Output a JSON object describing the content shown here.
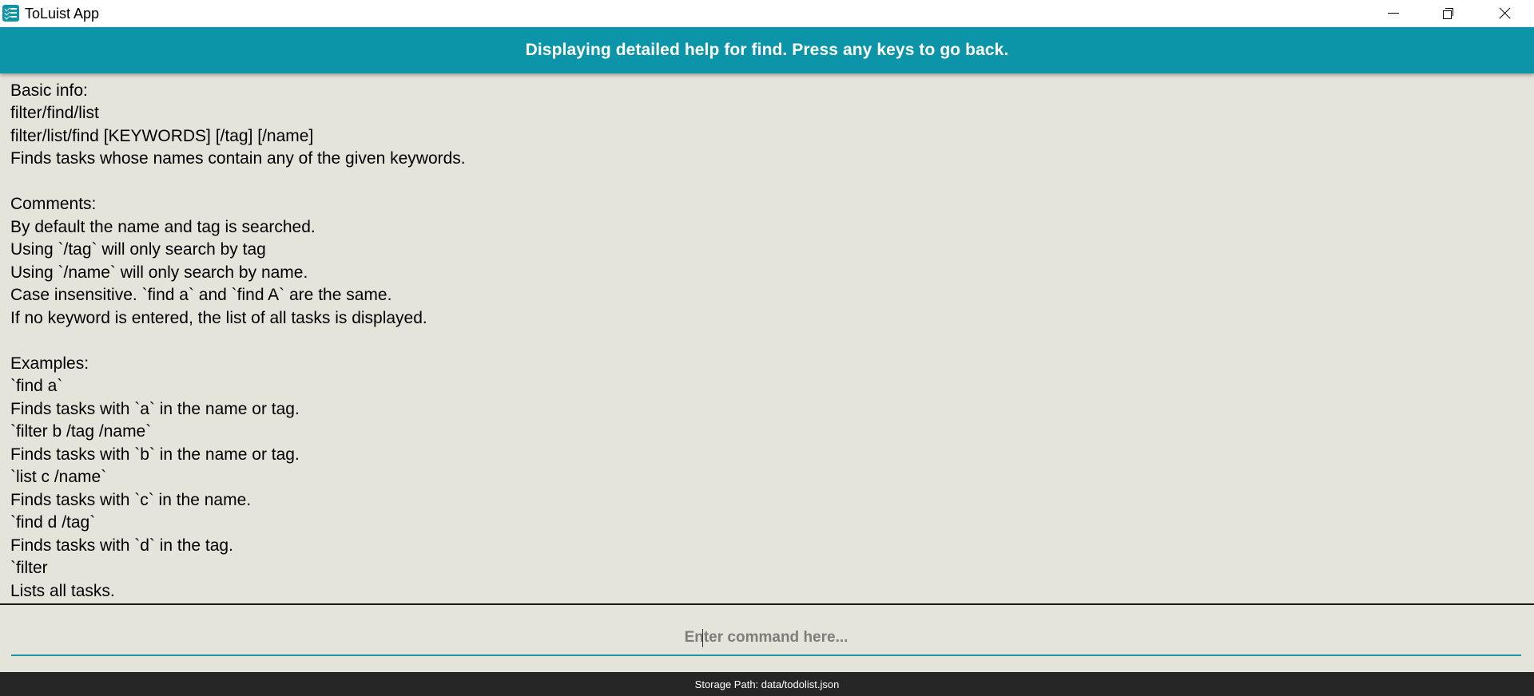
{
  "window": {
    "title": "ToLuist App",
    "app_icon": "checklist-icon",
    "controls": [
      "minimize-icon",
      "restore-icon",
      "close-icon"
    ]
  },
  "header": {
    "message": "Displaying detailed help for find. Press any keys to go back.",
    "color": "#0c95a8"
  },
  "help": {
    "lines": [
      "Basic info:",
      "filter/find/list",
      "filter/list/find [KEYWORDS] [/tag] [/name]",
      "Finds tasks whose names contain any of the given keywords.",
      "",
      "Comments:",
      "By default the name and tag is searched.",
      "Using `/tag` will only search by tag",
      "Using `/name` will only search by name.",
      "Case insensitive. `find a` and `find A` are the same.",
      "If no keyword is entered, the list of all tasks is displayed.",
      "",
      "Examples:",
      "`find a`",
      "Finds tasks with `a` in the name or tag.",
      "`filter b /tag /name`",
      "Finds tasks with `b` in the name or tag.",
      "`list c /name`",
      "Finds tasks with `c` in the name.",
      "`find d /tag`",
      "Finds tasks with `d` in the tag.",
      "`filter",
      "Lists all tasks."
    ]
  },
  "command": {
    "value": "",
    "placeholder": "Enter command here..."
  },
  "status": {
    "storage_path": "Storage Path: data/todolist.json"
  }
}
